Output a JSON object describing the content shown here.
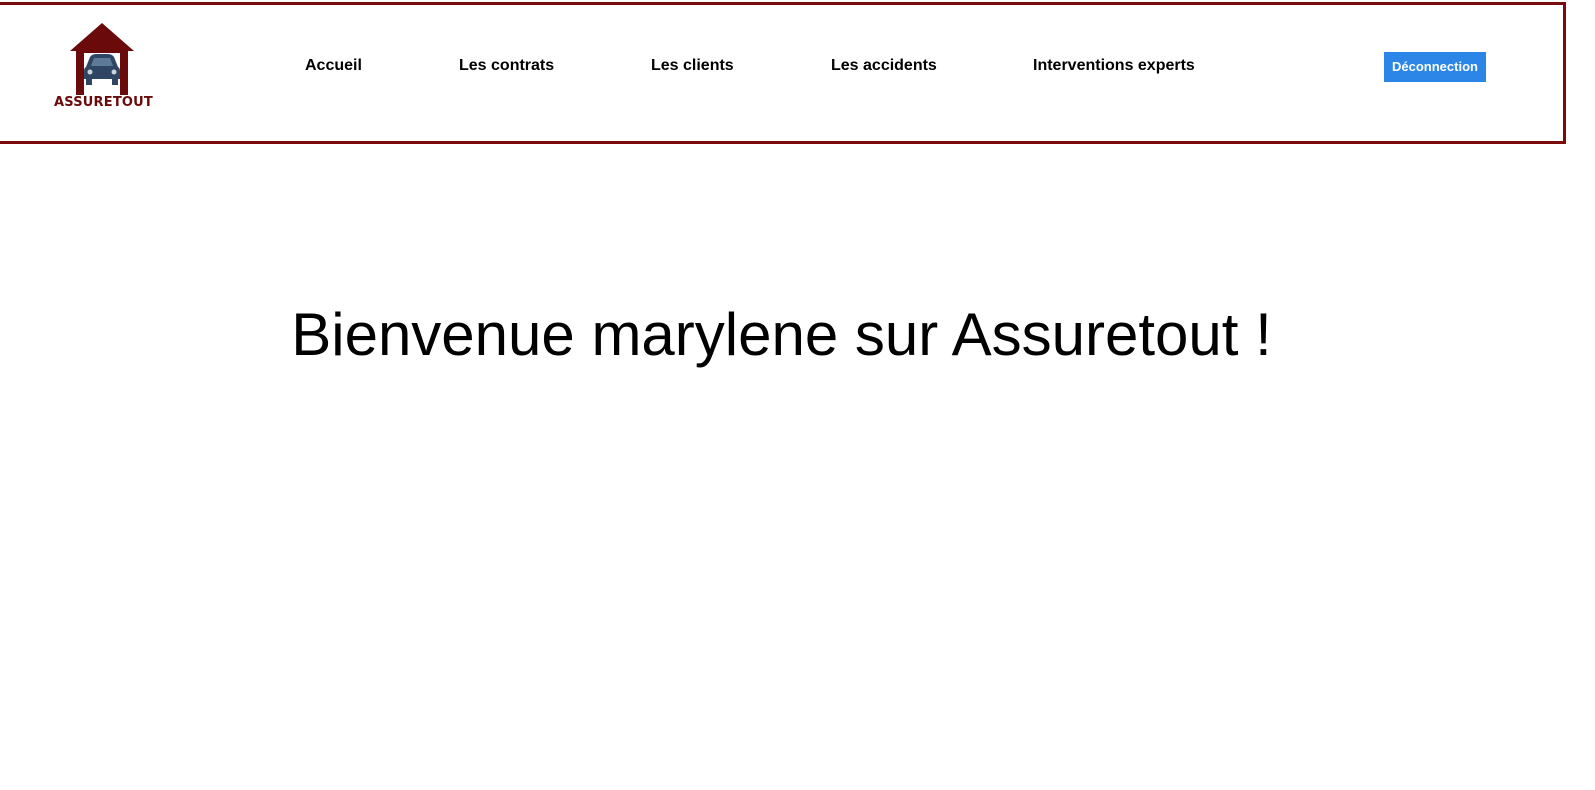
{
  "brand": {
    "name": "ASSURETOUT",
    "logo_icon": "house-car-icon",
    "color": "#6b0a0a"
  },
  "nav": {
    "items": [
      {
        "label": "Accueil"
      },
      {
        "label": "Les contrats"
      },
      {
        "label": "Les clients"
      },
      {
        "label": "Les accidents"
      },
      {
        "label": "Interventions experts"
      }
    ],
    "logout_label": "Déconnection"
  },
  "main": {
    "welcome": "Bienvenue marylene sur Assuretout !"
  },
  "colors": {
    "header_border": "#7a0b0b",
    "logout_bg": "#2b86e8"
  }
}
